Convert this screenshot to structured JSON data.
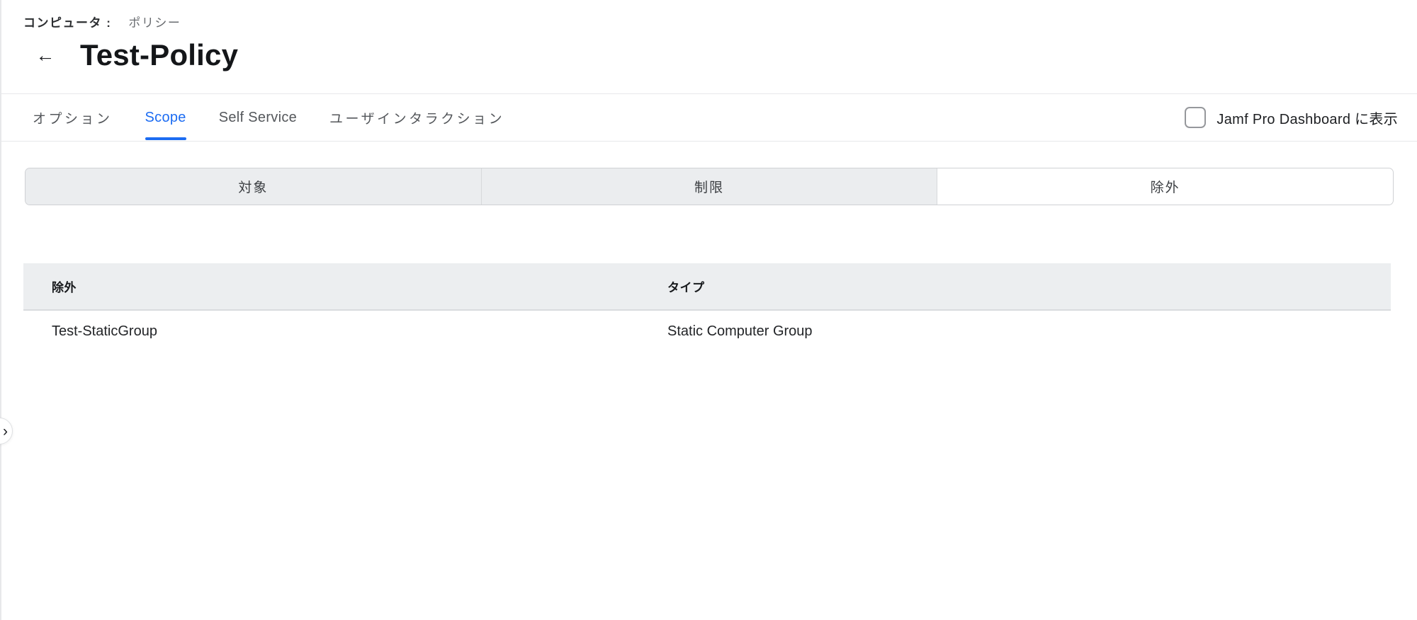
{
  "breadcrumb": {
    "items": [
      {
        "label": "コンピュータ :"
      },
      {
        "label": "ポリシー"
      }
    ]
  },
  "header": {
    "title": "Test-Policy"
  },
  "icons": {
    "back_arrow": "←",
    "sidebar_expand": "›"
  },
  "tab_bar": {
    "tabs": [
      {
        "label": "オプション",
        "active": false
      },
      {
        "label": "Scope",
        "active": true
      },
      {
        "label": "Self Service",
        "active": false
      },
      {
        "label": "ユーザインタラクション",
        "active": false
      }
    ],
    "dashboard_checkbox": {
      "label": "Jamf Pro Dashboard に表示",
      "checked": false
    }
  },
  "scope_segments": {
    "items": [
      {
        "label": "対象",
        "selected": false
      },
      {
        "label": "制限",
        "selected": false
      },
      {
        "label": "除外",
        "selected": true
      }
    ]
  },
  "exclusions_table": {
    "columns": [
      {
        "label": "除外"
      },
      {
        "label": "タイプ"
      }
    ],
    "rows": [
      {
        "name": "Test-StaticGroup",
        "type": "Static Computer Group"
      }
    ]
  },
  "colors": {
    "accent_blue": "#1c6cf2",
    "segment_bg": "#ebedef",
    "table_header_bg": "#eceef0",
    "divider": "#e7e8ea",
    "text_dark": "#1b1d20",
    "text_muted": "#54575b"
  }
}
